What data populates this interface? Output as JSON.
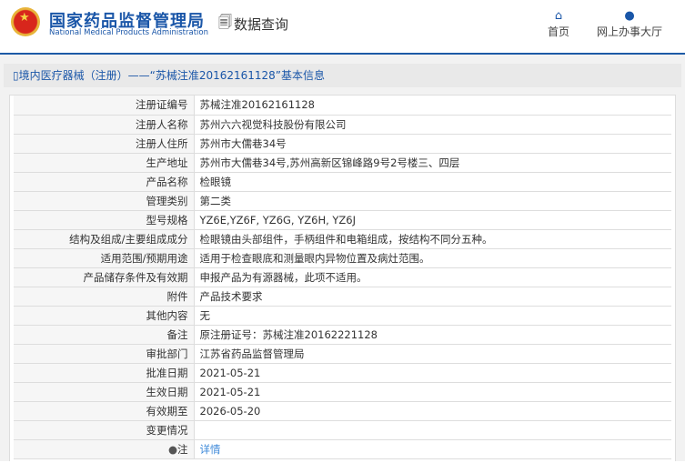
{
  "header": {
    "title_cn": "国家药品监督管理局",
    "title_en": "National Medical Products Administration",
    "query": "数据查询",
    "nav": [
      {
        "label": "首页",
        "icon": "home-icon"
      },
      {
        "label": "网上办事大厅",
        "icon": "user-icon"
      }
    ]
  },
  "breadcrumb": "境内医疗器械（注册）——“苏械注准20162161128”基本信息",
  "rows": [
    {
      "label": "注册证编号",
      "value": "苏械注准20162161128"
    },
    {
      "label": "注册人名称",
      "value": "苏州六六视觉科技股份有限公司"
    },
    {
      "label": "注册人住所",
      "value": "苏州市大儒巷34号"
    },
    {
      "label": "生产地址",
      "value": "苏州市大儒巷34号,苏州高新区锦峰路9号2号楼三、四层"
    },
    {
      "label": "产品名称",
      "value": "检眼镜"
    },
    {
      "label": "管理类别",
      "value": "第二类"
    },
    {
      "label": "型号规格",
      "value": "YZ6E,YZ6F, YZ6G, YZ6H, YZ6J"
    },
    {
      "label": "结构及组成/主要组成成分",
      "value": "检眼镜由头部组件，手柄组件和电箱组成，按结构不同分五种。"
    },
    {
      "label": "适用范围/预期用途",
      "value": "适用于检查眼底和测量眼内异物位置及病灶范围。"
    },
    {
      "label": "产品储存条件及有效期",
      "value": "申报产品为有源器械，此项不适用。"
    },
    {
      "label": "附件",
      "value": "产品技术要求"
    },
    {
      "label": "其他内容",
      "value": "无"
    },
    {
      "label": "备注",
      "value": "原注册证号：苏械注准20162221128"
    },
    {
      "label": "审批部门",
      "value": "江苏省药品监督管理局"
    },
    {
      "label": "批准日期",
      "value": "2021-05-21"
    },
    {
      "label": "生效日期",
      "value": "2021-05-21"
    },
    {
      "label": "有效期至",
      "value": "2026-05-20"
    },
    {
      "label": "变更情况",
      "value": ""
    }
  ],
  "note": {
    "label": "注",
    "link": "详情"
  }
}
